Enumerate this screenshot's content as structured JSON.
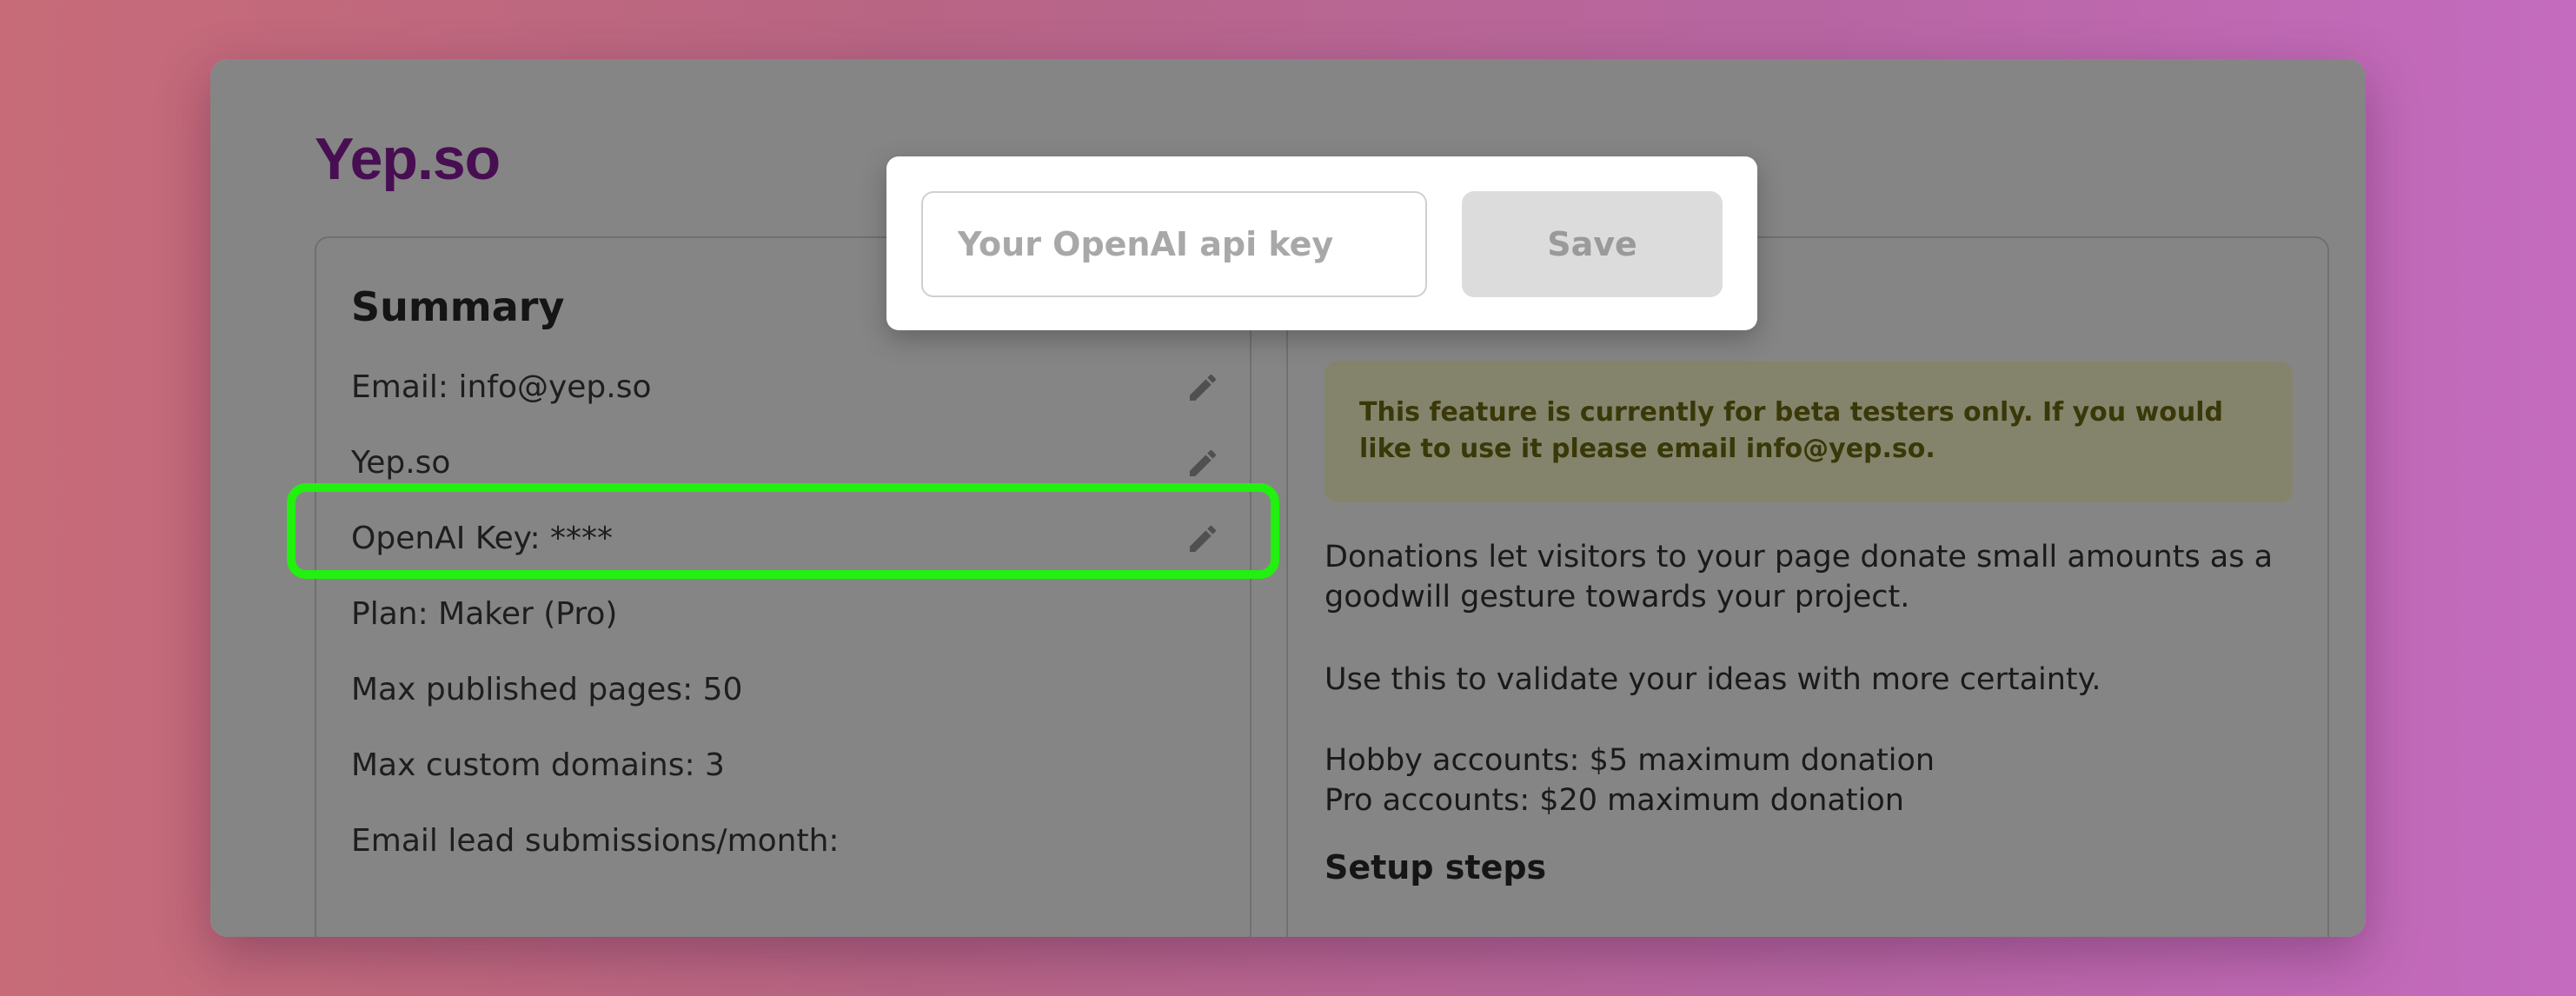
{
  "brand": "Yep.so",
  "summary": {
    "title": "Summary",
    "rows": [
      {
        "label": "Email: info@yep.so",
        "editable": true
      },
      {
        "label": "Yep.so",
        "editable": true
      },
      {
        "label": "OpenAI Key: ****",
        "editable": true
      },
      {
        "label": "Plan: Maker (Pro)",
        "editable": false
      },
      {
        "label": "Max published pages: 50",
        "editable": false
      },
      {
        "label": "Max custom domains: 3",
        "editable": false
      },
      {
        "label": "Email lead submissions/month:",
        "editable": false
      }
    ],
    "edit_icon": "pencil-icon"
  },
  "details": {
    "beta_notice": "This feature is currently for beta testers only. If you would like to use it please email info@yep.so.",
    "paragraphs": [
      "Donations let visitors to your page donate small amounts as a goodwill gesture towards your project.",
      "Use this to validate your ideas with more certainty.",
      "Hobby accounts: $5 maximum donation",
      "Pro accounts: $20 maximum donation"
    ],
    "setup_heading": "Setup steps"
  },
  "modal": {
    "input_placeholder": "Your OpenAI api key",
    "input_value": "",
    "save_label": "Save"
  },
  "colors": {
    "brand": "#8a1c9e",
    "highlight": "#22f00f",
    "beta_bg": "#fdfdd0",
    "beta_text": "#6e6b12"
  }
}
